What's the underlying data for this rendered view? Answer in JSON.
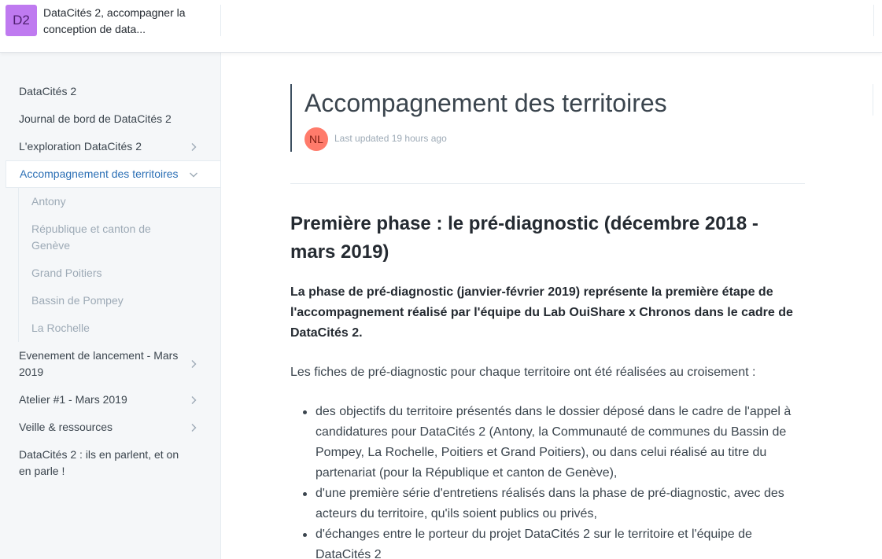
{
  "header": {
    "logo_text": "D2",
    "space_title": "DataCités 2, accompagner la conception de data..."
  },
  "sidebar": {
    "items": [
      {
        "label": "DataCités 2",
        "chevron": "none"
      },
      {
        "label": "Journal de bord de DataCités 2",
        "chevron": "none"
      },
      {
        "label": "L'exploration DataCités 2",
        "chevron": "right"
      },
      {
        "label": "Accompagnement des territoires",
        "chevron": "down",
        "active": true
      },
      {
        "label": "Evenement de lancement - Mars 2019",
        "chevron": "right"
      },
      {
        "label": "Atelier #1 - Mars 2019",
        "chevron": "right"
      },
      {
        "label": "Veille & ressources",
        "chevron": "right"
      },
      {
        "label": "DataCités 2 : ils en parlent, et on en parle !",
        "chevron": "none"
      }
    ],
    "subitems": [
      {
        "label": "Antony"
      },
      {
        "label": "République et canton de Genève"
      },
      {
        "label": "Grand Poitiers"
      },
      {
        "label": "Bassin de Pompey"
      },
      {
        "label": "La Rochelle"
      }
    ]
  },
  "page": {
    "title": "Accompagnement des territoires",
    "author_initials": "NL",
    "last_updated": "Last updated 19 hours ago"
  },
  "content": {
    "heading": "Première phase : le pré-diagnostic (décembre 2018 - mars 2019)",
    "lead": "La phase de pré-diagnostic (janvier-février 2019) représente la première étape de l'accompagnement réalisé par l'équipe du Lab OuiShare x Chronos dans le cadre de DataCités 2.",
    "intro": "Les fiches de pré-diagnostic pour chaque territoire ont été réalisées au croisement :",
    "bullets": [
      "des objectifs du territoire présentés dans le dossier déposé dans le cadre de l'appel à candidatures pour DataCités 2 (Antony, la Communauté de communes du Bassin de Pompey, La Rochelle, Poitiers et Grand Poitiers), ou dans celui réalisé au titre du partenariat (pour la République et canton de Genève),",
      "d'une première série d'entretiens réalisés dans la phase de pré-diagnostic,  avec des acteurs du territoire, qu'ils soient publics ou privés,",
      "d'échanges entre le porteur du projet DataCités 2 sur le territoire et l'équipe de DataCités 2"
    ]
  },
  "colors": {
    "logo_bg": "#bf7af0",
    "avatar_bg": "#ff7b6b",
    "active_nav": "#2b6fb5",
    "sidebar_bg": "#f5f7f9"
  }
}
